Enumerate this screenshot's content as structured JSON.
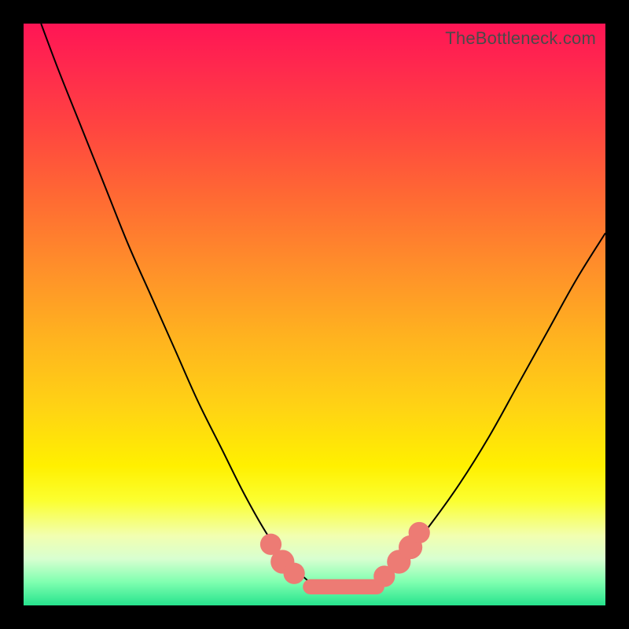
{
  "watermark": "TheBottleneck.com",
  "colors": {
    "frame": "#000000",
    "curve": "#000000",
    "marker": "#ed7b74",
    "gradient_top": "#ff1555",
    "gradient_bottom": "#26e38d"
  },
  "chart_data": {
    "type": "line",
    "title": "",
    "xlabel": "",
    "ylabel": "",
    "xlim": [
      0,
      100
    ],
    "ylim": [
      0,
      100
    ],
    "series": [
      {
        "name": "left-branch",
        "x": [
          3,
          6,
          10,
          14,
          18,
          22,
          26,
          30,
          34,
          38,
          42,
          45,
          48
        ],
        "y": [
          100,
          92,
          82,
          72,
          62,
          53,
          44,
          35,
          27,
          19,
          12,
          8,
          5
        ]
      },
      {
        "name": "valley-floor",
        "x": [
          48,
          50,
          53,
          56,
          59,
          62
        ],
        "y": [
          5,
          3.5,
          3,
          3,
          3.5,
          5
        ]
      },
      {
        "name": "right-branch",
        "x": [
          62,
          66,
          70,
          75,
          80,
          85,
          90,
          95,
          100
        ],
        "y": [
          5,
          9,
          14,
          21,
          29,
          38,
          47,
          56,
          64
        ]
      }
    ],
    "markers": [
      {
        "name": "left-dot-1",
        "x": 42.5,
        "y": 10.5,
        "r": 1.3
      },
      {
        "name": "left-dot-2",
        "x": 44.5,
        "y": 7.5,
        "r": 1.5
      },
      {
        "name": "left-dot-3",
        "x": 46.5,
        "y": 5.5,
        "r": 1.3
      },
      {
        "name": "right-dot-1",
        "x": 62.0,
        "y": 5.0,
        "r": 1.3
      },
      {
        "name": "right-dot-2",
        "x": 64.5,
        "y": 7.5,
        "r": 1.5
      },
      {
        "name": "right-dot-3",
        "x": 66.5,
        "y": 10.0,
        "r": 1.5
      },
      {
        "name": "right-dot-4",
        "x": 68.0,
        "y": 12.5,
        "r": 1.3
      }
    ],
    "floor_bar": {
      "x_start": 48,
      "x_end": 62,
      "y": 3.2,
      "thickness": 1.8
    }
  }
}
